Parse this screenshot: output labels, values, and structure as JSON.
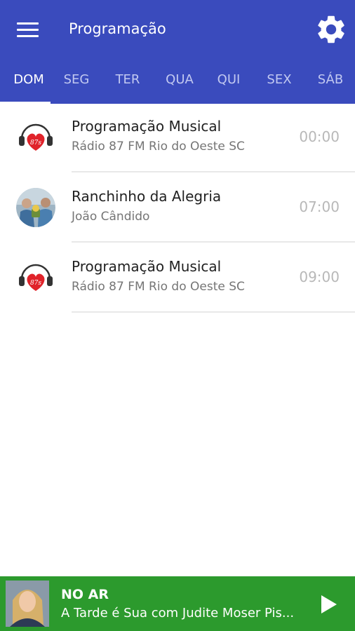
{
  "app_bar": {
    "title": "Programação",
    "menu_icon": "hamburger-menu-icon",
    "settings_icon": "gear-icon",
    "background": "#3a4bbd"
  },
  "tabs": [
    {
      "label": "DOM",
      "active": true
    },
    {
      "label": "SEG",
      "active": false
    },
    {
      "label": "TER",
      "active": false
    },
    {
      "label": "QUA",
      "active": false
    },
    {
      "label": "QUI",
      "active": false
    },
    {
      "label": "SEX",
      "active": false
    },
    {
      "label": "SÁB",
      "active": false
    }
  ],
  "schedule": [
    {
      "title": "Programação Musical",
      "subtitle": "Rádio 87 FM Rio do Oeste SC",
      "time": "00:00",
      "avatar": "radio-87-logo"
    },
    {
      "title": "Ranchinho da Alegria",
      "subtitle": "João Cândido",
      "time": "07:00",
      "avatar": "host-photo"
    },
    {
      "title": "Programação Musical",
      "subtitle": "Rádio 87 FM Rio do Oeste SC",
      "time": "09:00",
      "avatar": "radio-87-logo"
    }
  ],
  "now_playing": {
    "label": "NO AR",
    "track": "A Tarde é Sua com Judite Moser Pis...",
    "play_icon": "play-icon",
    "background": "#2c9a2d"
  }
}
